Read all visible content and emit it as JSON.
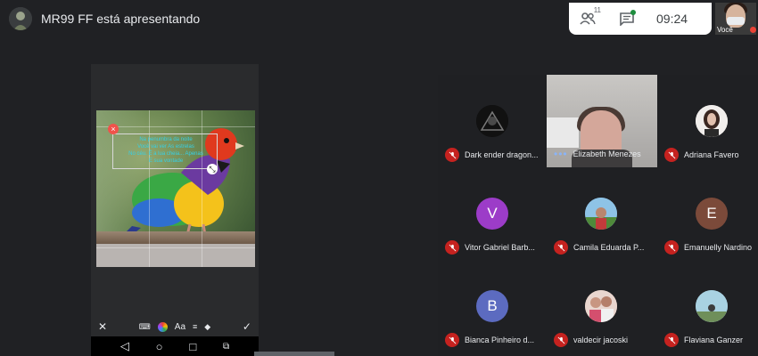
{
  "presenter": {
    "title": "MR99 FF está apresentando"
  },
  "top_panel": {
    "participants_count": "11",
    "time": "09:24"
  },
  "self_view": {
    "label": "Você"
  },
  "participants": [
    {
      "name": "Dark ender dragon...",
      "avatar": "image",
      "muted": true
    },
    {
      "name": "Elizabeth Menezes",
      "avatar": "video",
      "speaking": true
    },
    {
      "name": "Adriana Favero",
      "avatar": "image",
      "muted": true
    },
    {
      "name": "Vitor Gabriel Barb...",
      "avatar": "V",
      "avatar_color": "#9c3cc8",
      "muted": true
    },
    {
      "name": "Camila Eduarda P...",
      "avatar": "image",
      "muted": true
    },
    {
      "name": "Emanuelly Nardino",
      "avatar": "E",
      "avatar_color": "#7b4a3a",
      "muted": true
    },
    {
      "name": "Bianca Pinheiro d...",
      "avatar": "B",
      "avatar_color": "#5c6bc0",
      "muted": true
    },
    {
      "name": "valdecir jacoski",
      "avatar": "image",
      "muted": true
    },
    {
      "name": "Flaviana Ganzer",
      "avatar": "image",
      "muted": true
    }
  ],
  "shared_screen": {
    "caption_lines": [
      "Na penumbra da noite",
      "Você vai ver As estrelas",
      "No céu. É a lua cheia... Apenas",
      "E sua vontade"
    ],
    "toolbar": {
      "close": "✕",
      "text": "Aa",
      "confirm": "✓"
    }
  },
  "colors": {
    "mute": "#c5221f",
    "speaking": "#8ab4f8"
  }
}
